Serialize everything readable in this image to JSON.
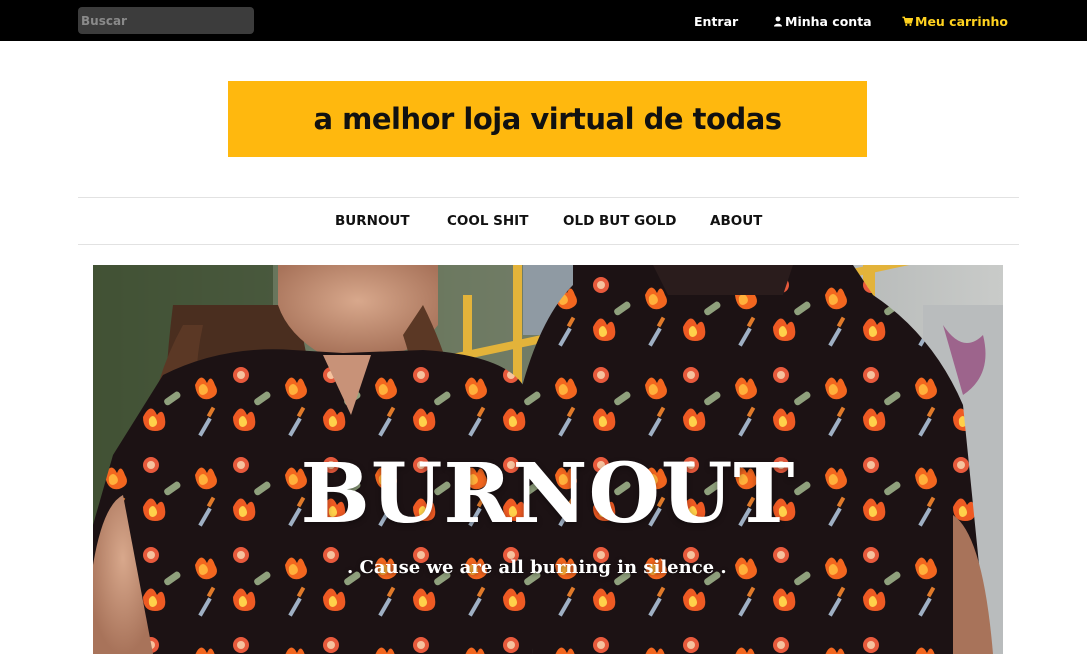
{
  "topbar": {
    "search_placeholder": "Buscar",
    "login_label": "Entrar",
    "account_label": "Minha conta",
    "account_icon": "user-icon",
    "cart_label": "Meu carrinho",
    "cart_icon": "cart-icon",
    "cart_color": "#ffd21f"
  },
  "banner": {
    "text": "a melhor loja virtual de todas",
    "color": "#ffb80e"
  },
  "nav": {
    "items": [
      {
        "label": "BURNOUT"
      },
      {
        "label": "COOL SHIT"
      },
      {
        "label": "OLD BUT GOLD"
      },
      {
        "label": "ABOUT"
      }
    ]
  },
  "hero": {
    "title": "BURNOUT",
    "subtitle": ". Cause we are all burning in silence .",
    "shirt_color": "#1c1214"
  }
}
